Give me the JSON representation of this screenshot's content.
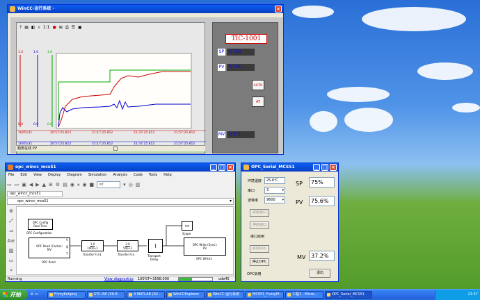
{
  "wincc": {
    "title": "WinCC-运行系统 - ",
    "status": "趋势在线 PV",
    "tag": "TIC-1001",
    "sp_label": "SP",
    "sp_value": "0.750",
    "pv_label": "PV",
    "pv_value": "0.755",
    "mv_label": "MV",
    "mv_value": "0.371",
    "auto_btn": "AUTO",
    "at_btn": "AT",
    "toolbar_zoom": "1:1",
    "axis_top": "1.0",
    "axis_bottom": "0.0",
    "time_rows": [
      {
        "date": "16/05/31",
        "t1": "20:57:25.812",
        "t2": "21:17:25.812",
        "t3": "21:37:25.812",
        "t4": "21:57:25.812"
      },
      {
        "date": "16/05/31",
        "t1": "20:57:25.812",
        "t2": "21:17:25.812",
        "t3": "21:37:25.812",
        "t4": "21:57:25.812"
      },
      {
        "date": "16/05/31",
        "t1": "20:57:25.812",
        "t2": "21:17:25.812",
        "t3": "21:37:25.812",
        "t4": "21:57:25.812"
      }
    ]
  },
  "simulink": {
    "title": "opc_wincc_mcs51",
    "menu": [
      "File",
      "Edit",
      "View",
      "Display",
      "Diagram",
      "Simulation",
      "Analysis",
      "Code",
      "Tools",
      "Help"
    ],
    "stop_time": "inf",
    "breadcrumb": "opc_wincc_mcs51",
    "path": "opc_wincc_mcs51",
    "status_left": "Running",
    "status_mid": "View diagnostics",
    "status_zoom": "100%",
    "status_time": "T=3598.000",
    "status_solver": "ode45",
    "blocks": {
      "config_line1": "OPC Config",
      "config_line2": "Real-Time",
      "config_cap": "OPC Configuration",
      "read_line1": "OPC Read (Cache):",
      "read_line2": "MV",
      "read_cap": "OPC Read",
      "tf1_num": "1.0",
      "tf1_den": "100s+1",
      "tf1_cap": "Transfer Fcn1",
      "tf2_num": "2.0",
      "tf2_den": "50s+1",
      "tf2_cap": "Transfer Fcn",
      "delay_cap1": "Transport",
      "delay_cap2": "Delay",
      "scope_cap": "Scope",
      "write_line1": "OPC Write (Sync):",
      "write_line2": "PV",
      "write_cap": "OPC Write1",
      "port_v": "V",
      "port_q": "Q",
      "port_t": "T"
    }
  },
  "serial": {
    "title": "OPC_Serial_MCS51",
    "env_temp_label": "环境温度",
    "env_temp_value": "25.6℃",
    "port_label": "串口",
    "port_value": "3",
    "baud_label": "波特率",
    "baud_value": "9600",
    "btn_open": "启用串口",
    "btn_close": "停用串口",
    "port_status": "串口启用",
    "btn_start_opc": "启动OPC",
    "btn_stop_opc": "停止OPC",
    "opc_status": "OPC启用",
    "sp_label": "SP",
    "sp_value": "75%",
    "pv_label": "PV",
    "pv_value": "75.6%",
    "mv_label": "MV",
    "mv_value": "37.2%",
    "btn_exit": "退出"
  },
  "taskbar": {
    "start": "开始",
    "items": [
      "F:\\myKeilproj",
      "STC-ISP (V6.8",
      "4 MATLAB (R2...",
      "WinCCExplorer",
      "WinCC-运行系统",
      "MCS51_FuzzyPI...",
      "工程1 - Micro...",
      "OPC_Serial_MCS51"
    ],
    "clock": "21:57"
  }
}
